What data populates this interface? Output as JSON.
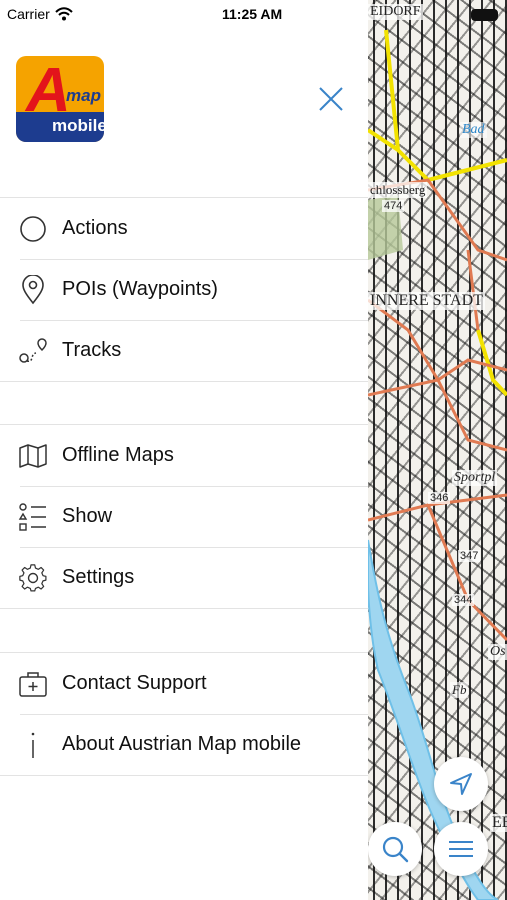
{
  "status_bar": {
    "carrier": "Carrier",
    "time": "11:25 AM"
  },
  "app": {
    "logo_letter": "A",
    "logo_word_top": "map",
    "logo_word_bottom": "mobile"
  },
  "menu": {
    "group1": [
      {
        "label": "Actions",
        "icon": "circle-icon"
      },
      {
        "label": "POIs (Waypoints)",
        "icon": "location-pin-icon"
      },
      {
        "label": "Tracks",
        "icon": "track-route-icon"
      }
    ],
    "group2": [
      {
        "label": "Offline Maps",
        "icon": "map-icon"
      },
      {
        "label": "Show",
        "icon": "layers-list-icon"
      },
      {
        "label": "Settings",
        "icon": "gear-icon"
      }
    ],
    "group3": [
      {
        "label": "Contact Support",
        "icon": "first-aid-kit-icon"
      },
      {
        "label": "About Austrian Map mobile",
        "icon": "info-icon"
      }
    ]
  },
  "map": {
    "labels": {
      "north": "EIDORF",
      "bad": "Bad",
      "schlossberg": "chlossberg",
      "schlossberg_elev": "474",
      "innere_stadt": "INNERE STADT",
      "elev_346": "346",
      "sportpl": "Sportpl",
      "elev_347": "347",
      "elev_344": "344",
      "os": "Os",
      "fb": "Fb",
      "ebe": "EBE"
    }
  },
  "colors": {
    "accent": "#3a84c9",
    "road_yellow": "#f2e200",
    "road_orange": "#e07a52",
    "river_blue": "#6fc0e8"
  }
}
